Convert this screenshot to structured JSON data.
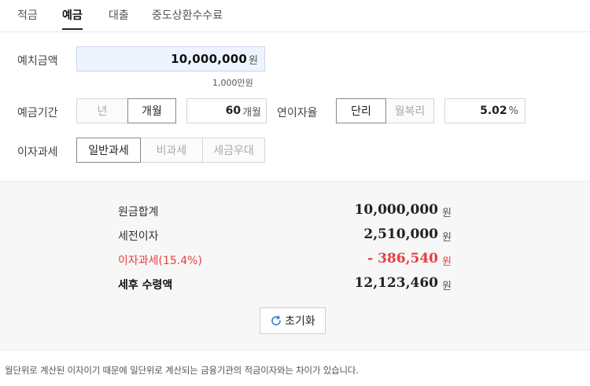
{
  "tabs": [
    {
      "label": "적금"
    },
    {
      "label": "예금"
    },
    {
      "label": "대출"
    },
    {
      "label": "중도상환수수료"
    }
  ],
  "form": {
    "deposit_label": "예치금액",
    "deposit_value": "10,000,000",
    "deposit_unit": "원",
    "deposit_hint": "1,000만원",
    "period_label": "예금기간",
    "period_options": [
      "년",
      "개월"
    ],
    "period_selected": "개월",
    "period_value": "60",
    "period_unit": "개월",
    "rate_label": "연이자율",
    "rate_types": [
      "단리",
      "월복리"
    ],
    "rate_type_selected": "단리",
    "rate_value": "5.02",
    "rate_unit": "%",
    "tax_label": "이자과세",
    "tax_options": [
      "일반과세",
      "비과세",
      "세금우대"
    ],
    "tax_selected": "일반과세"
  },
  "summary": {
    "principal_label": "원금합계",
    "principal_value": "10,000,000",
    "pretax_label": "세전이자",
    "pretax_value": "2,510,000",
    "tax_label": "이자과세(15.4%)",
    "tax_value": "- 386,540",
    "net_label": "세후 수령액",
    "net_value": "12,123,460",
    "unit": "원",
    "reset_label": "초기화"
  },
  "note": "월단위로 계산된 이자이기 때문에 일단위로 계산되는 금융기관의 적금이자와는 차이가 있습니다.",
  "colors": {
    "accent_input_bg": "#eef4ff",
    "tax_red": "#ea3d3d",
    "reset_icon_blue": "#3a7bd5"
  },
  "icons": {
    "reset": "refresh-icon"
  }
}
